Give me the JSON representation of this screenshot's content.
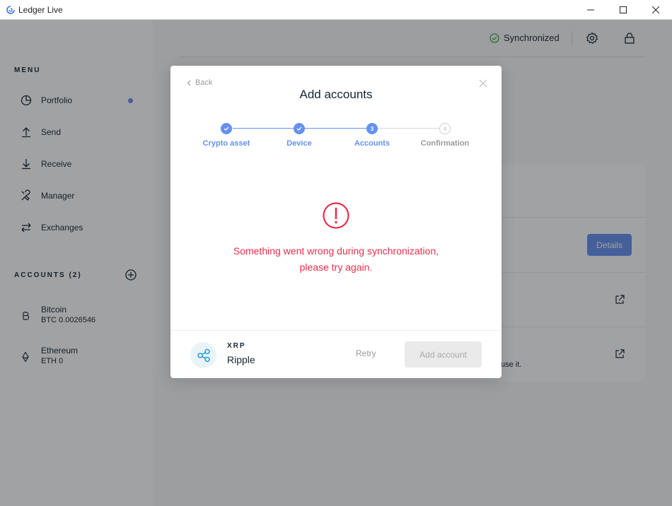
{
  "window": {
    "title": "Ledger Live"
  },
  "sidebar": {
    "menu_heading": "MENU",
    "items": [
      {
        "label": "Portfolio",
        "icon": "pie-chart-icon"
      },
      {
        "label": "Send",
        "icon": "arrow-up-icon"
      },
      {
        "label": "Receive",
        "icon": "arrow-down-icon"
      },
      {
        "label": "Manager",
        "icon": "tools-icon"
      },
      {
        "label": "Exchanges",
        "icon": "exchange-arrows-icon"
      }
    ],
    "accounts_heading": "ACCOUNTS (2)",
    "accounts": [
      {
        "name": "Bitcoin",
        "balance": "BTC 0.0026546",
        "icon": "bitcoin-icon"
      },
      {
        "name": "Ethereum",
        "balance": "ETH 0",
        "icon": "ethereum-icon"
      }
    ]
  },
  "topbar": {
    "sync_status": "Synchronized"
  },
  "background": {
    "details_label": "Details",
    "trail_text": "use it."
  },
  "modal": {
    "back_label": "Back",
    "title": "Add accounts",
    "steps": [
      {
        "label": "Crypto asset",
        "state": "done"
      },
      {
        "label": "Device",
        "state": "done"
      },
      {
        "label": "Accounts",
        "state": "active",
        "number": "3"
      },
      {
        "label": "Confirmation",
        "state": "pending",
        "number": "4"
      }
    ],
    "error_line1": "Something went wrong during synchronization,",
    "error_line2": "please try again.",
    "coin_ticker": "XRP",
    "coin_name": "Ripple",
    "retry_label": "Retry",
    "add_account_label": "Add account"
  },
  "colors": {
    "accent": "#6490f1",
    "error": "#ea2e49",
    "success": "#41a84d"
  }
}
